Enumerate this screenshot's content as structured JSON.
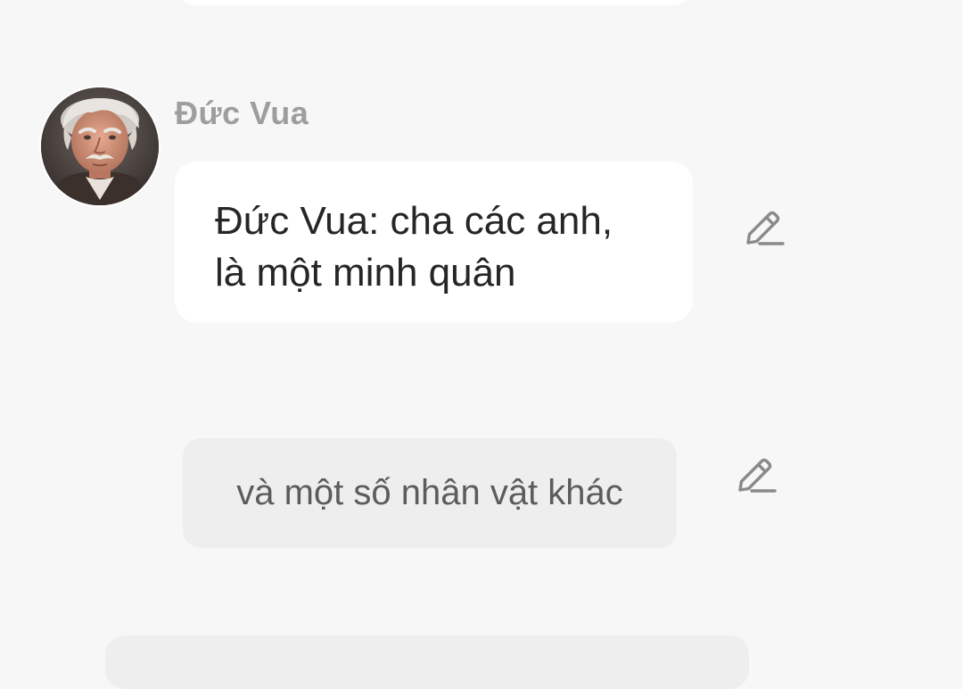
{
  "chat": {
    "messages": [
      {
        "sender": "Đức Vua",
        "text_line1": "Đức Vua: cha các anh,",
        "text_line2": "là một minh quân",
        "avatar_icon": "old-man-portrait",
        "edit_icon": "pencil-edit-icon"
      },
      {
        "type": "narration",
        "text": "và một số nhân vật khác",
        "edit_icon": "pencil-edit-icon"
      }
    ]
  },
  "colors": {
    "background": "#f7f7f7",
    "bubble_white": "#ffffff",
    "bubble_gray": "#eeeeee",
    "sender_name": "#9e9e9e",
    "message_text": "#262626",
    "narration_text": "#5c5c5c",
    "icon_gray": "#8a8a8a"
  }
}
